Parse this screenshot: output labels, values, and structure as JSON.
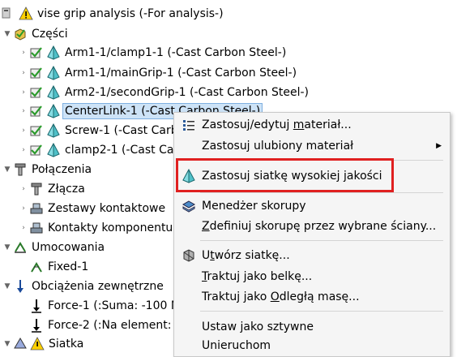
{
  "tree": {
    "root": "vise grip analysis (-For analysis-)",
    "parts_label": "Części",
    "parts": [
      "Arm1-1/clamp1-1 (-Cast Carbon Steel-)",
      "Arm1-1/mainGrip-1 (-Cast Carbon Steel-)",
      "Arm2-1/secondGrip-1 (-Cast Carbon Steel-)",
      "CenterLink-1 (-Cast Carbon Steel-)",
      "Screw-1 (-Cast Carb",
      "clamp2-1 (-Cast Carb"
    ],
    "connections_label": "Połączenia",
    "connections": [
      "Złącza",
      "Zestawy kontaktowe",
      "Kontakty komponentu"
    ],
    "fixtures_label": "Umocowania",
    "fixtures": [
      "Fixed-1"
    ],
    "loads_label": "Obciążenia zewnętrzne",
    "loads": [
      "Force-1 (:Suma: -100 N",
      "Force-2 (:Na element: "
    ],
    "mesh_label": "Siatka"
  },
  "menu": {
    "items": [
      {
        "pre": "Zastosuj/edytuj ",
        "u": "m",
        "post": "ateriał..."
      },
      {
        "pre": "Zastosuj ulubiony materiał",
        "u": "",
        "post": ""
      },
      {
        "pre": "Zastosuj siatkę wysokiej jakości",
        "u": "",
        "post": ""
      },
      {
        "pre": "Menedżer skorupy",
        "u": "",
        "post": ""
      },
      {
        "pre": "",
        "u": "Z",
        "post": "definiuj skorupę przez wybrane ściany..."
      },
      {
        "pre": "U",
        "u": "t",
        "post": "wórz siatkę..."
      },
      {
        "pre": "",
        "u": "T",
        "post": "raktuj jako belkę..."
      },
      {
        "pre": "Traktuj jako ",
        "u": "O",
        "post": "dległą masę..."
      },
      {
        "pre": "Ustaw jako sztywne",
        "u": "",
        "post": ""
      },
      {
        "pre": "Unieruchom",
        "u": "",
        "post": ""
      }
    ],
    "submenu_arrow": "▶"
  },
  "colors": {
    "selection": "#cde3f7",
    "highlight_border": "#e02020",
    "menu_bg": "#f5f5f5"
  }
}
